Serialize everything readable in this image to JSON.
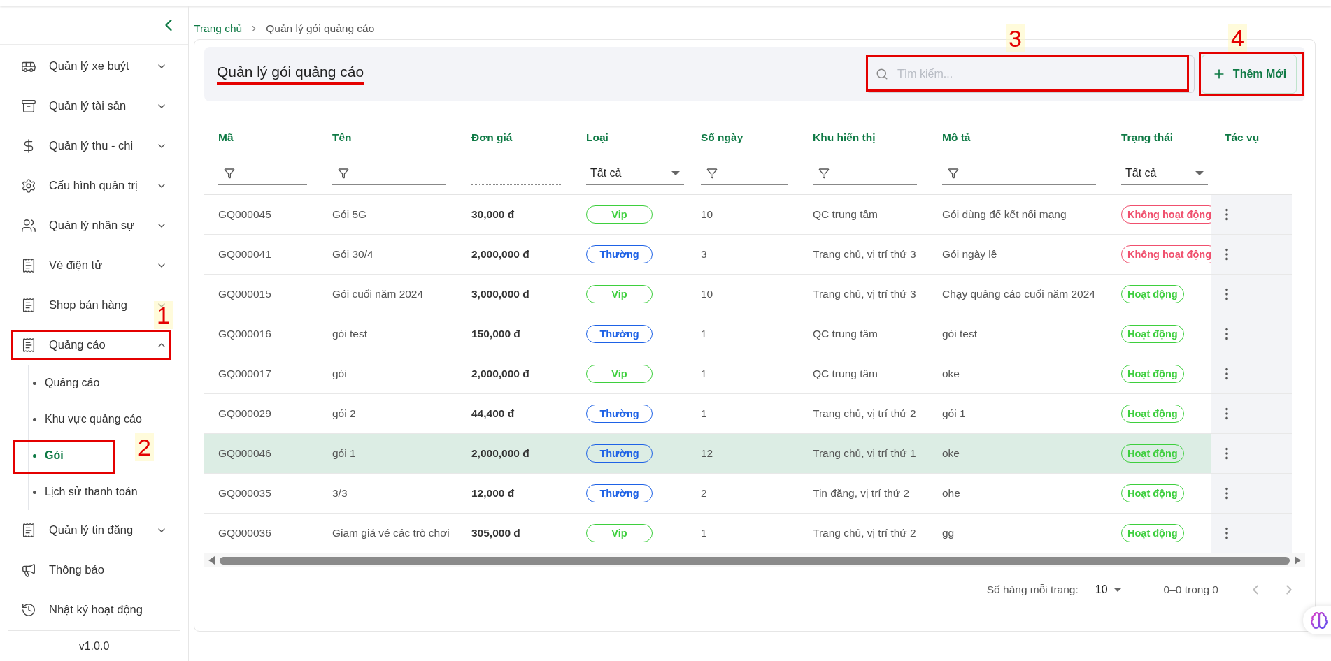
{
  "sidebar": {
    "items": [
      {
        "label": "Quản lý xe buýt",
        "kind": "group",
        "expanded": false
      },
      {
        "label": "Quản lý tài sản",
        "kind": "group",
        "expanded": false
      },
      {
        "label": "Quản lý thu - chi",
        "kind": "group",
        "expanded": false
      },
      {
        "label": "Cấu hình quản trị",
        "kind": "group",
        "expanded": false
      },
      {
        "label": "Quản lý nhân sự",
        "kind": "group",
        "expanded": false
      },
      {
        "label": "Vé điện tử",
        "kind": "group",
        "expanded": false
      },
      {
        "label": "Shop bán hàng",
        "kind": "group",
        "expanded": false
      },
      {
        "label": "Quảng cáo",
        "kind": "group",
        "expanded": true,
        "callout": "1",
        "children": [
          {
            "label": "Quảng cáo",
            "selected": false
          },
          {
            "label": "Khu vực quảng cáo",
            "selected": false
          },
          {
            "label": "Gói",
            "selected": true,
            "callout": "2"
          },
          {
            "label": "Lịch sử thanh toán",
            "selected": false
          }
        ]
      },
      {
        "label": "Quản lý tin đăng",
        "kind": "group",
        "expanded": false
      },
      {
        "label": "Thông báo",
        "kind": "link"
      },
      {
        "label": "Nhật ký hoạt động",
        "kind": "link"
      }
    ],
    "version": "v1.0.0"
  },
  "breadcrumb": [
    {
      "label": "Trang chủ",
      "selected": false
    },
    {
      "label": "Quản lý gói quảng cáo",
      "selected": true
    }
  ],
  "header": {
    "title": "Quản lý gói quảng cáo",
    "underlined": true,
    "search": {
      "placeholder": "Tìm kiếm...",
      "callout": "3"
    },
    "add_button": {
      "label": "Thêm Mới",
      "callout": "4"
    }
  },
  "table": {
    "columns": [
      {
        "label": "Mã",
        "filter": {
          "kind": "text"
        }
      },
      {
        "label": "Tên",
        "filter": {
          "kind": "text"
        }
      },
      {
        "label": "Đơn giá",
        "filter": {
          "kind": "blank"
        }
      },
      {
        "label": "Loại",
        "filter": {
          "kind": "select",
          "value": "Tất cả"
        }
      },
      {
        "label": "Số ngày",
        "filter": {
          "kind": "text"
        }
      },
      {
        "label": "Khu hiển thị",
        "filter": {
          "kind": "text"
        }
      },
      {
        "label": "Mô tả",
        "filter": {
          "kind": "text"
        }
      },
      {
        "label": "Trạng thái",
        "filter": {
          "kind": "select",
          "value": "Tất cả"
        }
      },
      {
        "label": "Tác vụ",
        "filter": {
          "kind": "none"
        }
      }
    ],
    "rows": [
      {
        "code": "GQ000045",
        "name": "Gói 5G",
        "price": "30,000 đ",
        "type": {
          "label": "Vip",
          "color": "#3ecf3e"
        },
        "days": "10",
        "area": "QC trung tâm",
        "description": "Gói dùng để kết nối mạng",
        "status": {
          "label": "Không hoạt động",
          "color": "#f0506e"
        },
        "highlighted": false
      },
      {
        "code": "GQ000041",
        "name": "Gói 30/4",
        "price": "2,000,000 đ",
        "type": {
          "label": "Thường",
          "color": "#1e62e6"
        },
        "days": "3",
        "area": "Trang chủ, vị trí thứ 3",
        "description": "Gói ngày lễ",
        "status": {
          "label": "Không hoạt động",
          "color": "#f0506e"
        },
        "highlighted": false
      },
      {
        "code": "GQ000015",
        "name": "Gói cuối năm 2024",
        "price": "3,000,000 đ",
        "type": {
          "label": "Vip",
          "color": "#3ecf3e"
        },
        "days": "10",
        "area": "Trang chủ, vị trí thứ 3",
        "description": "Chạy quảng cáo cuối năm 2024",
        "status": {
          "label": "Hoạt động",
          "color": "#3ecf3e"
        },
        "highlighted": false
      },
      {
        "code": "GQ000016",
        "name": "gói test",
        "price": "150,000 đ",
        "type": {
          "label": "Thường",
          "color": "#1e62e6"
        },
        "days": "1",
        "area": "QC trung tâm",
        "description": "gói test",
        "status": {
          "label": "Hoạt động",
          "color": "#3ecf3e"
        },
        "highlighted": false
      },
      {
        "code": "GQ000017",
        "name": "gói",
        "price": "2,000,000 đ",
        "type": {
          "label": "Vip",
          "color": "#3ecf3e"
        },
        "days": "1",
        "area": "QC trung tâm",
        "description": "oke",
        "status": {
          "label": "Hoạt động",
          "color": "#3ecf3e"
        },
        "highlighted": false
      },
      {
        "code": "GQ000029",
        "name": "gói 2",
        "price": "44,400 đ",
        "type": {
          "label": "Thường",
          "color": "#1e62e6"
        },
        "days": "1",
        "area": "Trang chủ, vị trí thứ 2",
        "description": "gói 1",
        "status": {
          "label": "Hoạt động",
          "color": "#3ecf3e"
        },
        "highlighted": false
      },
      {
        "code": "GQ000046",
        "name": "gói 1",
        "price": "2,000,000 đ",
        "type": {
          "label": "Thường",
          "color": "#1e62e6"
        },
        "days": "12",
        "area": "Trang chủ, vị trí thứ 1",
        "description": "oke",
        "status": {
          "label": "Hoạt động",
          "color": "#3ecf3e"
        },
        "highlighted": true
      },
      {
        "code": "GQ000035",
        "name": "3/3",
        "price": "12,000 đ",
        "type": {
          "label": "Thường",
          "color": "#1e62e6"
        },
        "days": "2",
        "area": "Tin đăng, vị trí thứ 2",
        "description": "ohe",
        "status": {
          "label": "Hoạt động",
          "color": "#3ecf3e"
        },
        "highlighted": false
      },
      {
        "code": "GQ000036",
        "name": "Gỉam giá vé các trò chơi",
        "price": "305,000 đ",
        "type": {
          "label": "Vip",
          "color": "#3ecf3e"
        },
        "days": "1",
        "area": "Trang chủ, vị trí thứ 2",
        "description": "gg",
        "status": {
          "label": "Hoạt động",
          "color": "#3ecf3e"
        },
        "highlighted": false
      }
    ]
  },
  "pagination": {
    "rows_label": "Số hàng mỗi trang:",
    "rows_value": "10",
    "range": "0–0 trong 0",
    "prev": {
      "disabled": true
    },
    "next": {
      "disabled": true
    }
  }
}
